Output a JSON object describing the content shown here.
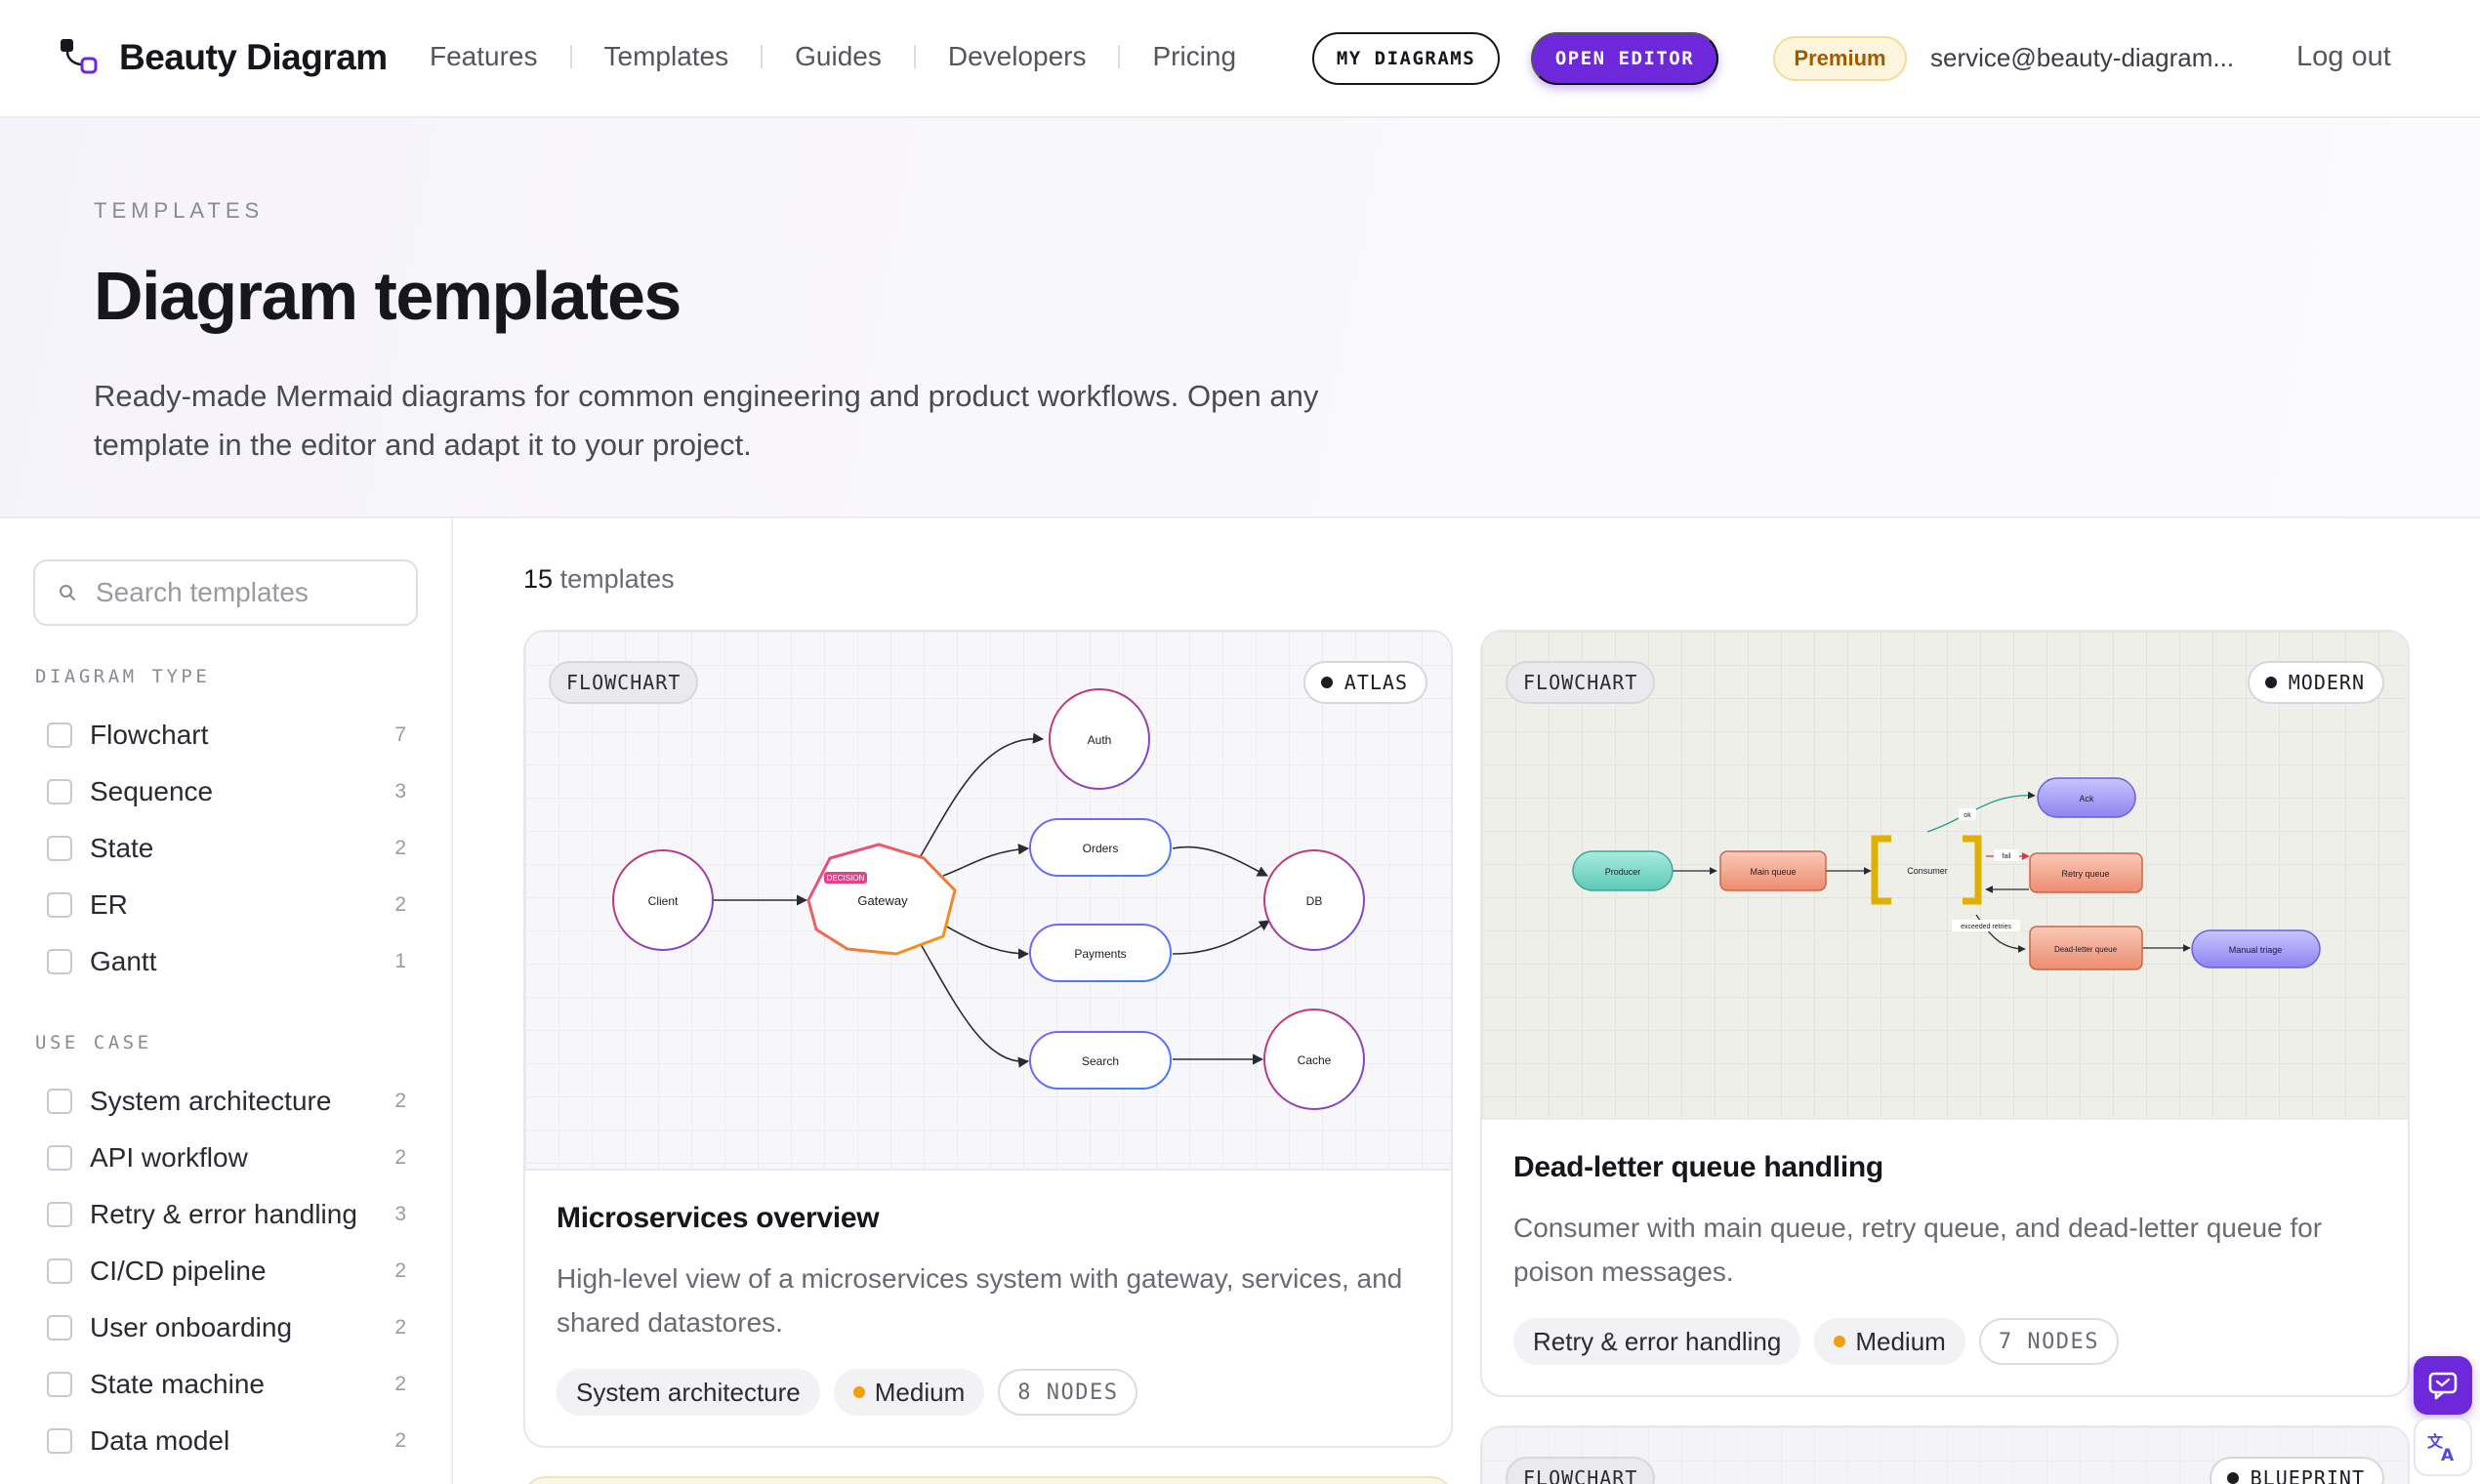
{
  "header": {
    "brand": "Beauty Diagram",
    "nav": [
      "Features",
      "Templates",
      "Guides",
      "Developers",
      "Pricing"
    ],
    "my_diagrams": "MY DIAGRAMS",
    "open_editor": "OPEN EDITOR",
    "plan_badge": "Premium",
    "user_email": "service@beauty-diagram...",
    "logout": "Log out"
  },
  "hero": {
    "eyebrow": "TEMPLATES",
    "title": "Diagram templates",
    "description": "Ready-made Mermaid diagrams for common engineering and product workflows. Open any template in the editor and adapt it to your project."
  },
  "sidebar": {
    "search_placeholder": "Search templates",
    "diagram_type": {
      "heading": "DIAGRAM TYPE",
      "items": [
        {
          "label": "Flowchart",
          "count": "7"
        },
        {
          "label": "Sequence",
          "count": "3"
        },
        {
          "label": "State",
          "count": "2"
        },
        {
          "label": "ER",
          "count": "2"
        },
        {
          "label": "Gantt",
          "count": "1"
        }
      ]
    },
    "use_case": {
      "heading": "USE CASE",
      "items": [
        {
          "label": "System architecture",
          "count": "2"
        },
        {
          "label": "API workflow",
          "count": "2"
        },
        {
          "label": "Retry & error handling",
          "count": "3"
        },
        {
          "label": "CI/CD pipeline",
          "count": "2"
        },
        {
          "label": "User onboarding",
          "count": "2"
        },
        {
          "label": "State machine",
          "count": "2"
        },
        {
          "label": "Data model",
          "count": "2"
        }
      ]
    }
  },
  "results": {
    "count": "15",
    "label": "templates"
  },
  "cards": [
    {
      "type": "FLOWCHART",
      "theme": "ATLAS",
      "title": "Microservices overview",
      "description": "High-level view of a microservices system with gateway, services, and shared datastores.",
      "use_case": "System architecture",
      "difficulty": "Medium",
      "nodes": "8 NODES",
      "diagram": {
        "nodes": [
          "Client",
          "Gateway",
          "Auth",
          "Orders",
          "Payments",
          "Search",
          "DB",
          "Cache"
        ],
        "decision_badge": "DECISION"
      }
    },
    {
      "type": "FLOWCHART",
      "theme": "MODERN",
      "title": "Dead-letter queue handling",
      "description": "Consumer with main queue, retry queue, and dead-letter queue for poison messages.",
      "use_case": "Retry & error handling",
      "difficulty": "Medium",
      "nodes": "7 NODES",
      "diagram": {
        "nodes": [
          "Producer",
          "Main queue",
          "Consumer",
          "Ack",
          "Retry queue",
          "Dead-letter queue",
          "Manual triage"
        ],
        "edge_labels": [
          "ok",
          "fail",
          "exceeded retries"
        ]
      }
    },
    {
      "type": "FLOWCHART",
      "theme": "BLUEPRINT"
    }
  ],
  "colors": {
    "accent": "#6d28d9",
    "premium_text": "#a15a00",
    "premium_bg": "#fdf6dc",
    "medium_dot": "#f59e0b"
  }
}
